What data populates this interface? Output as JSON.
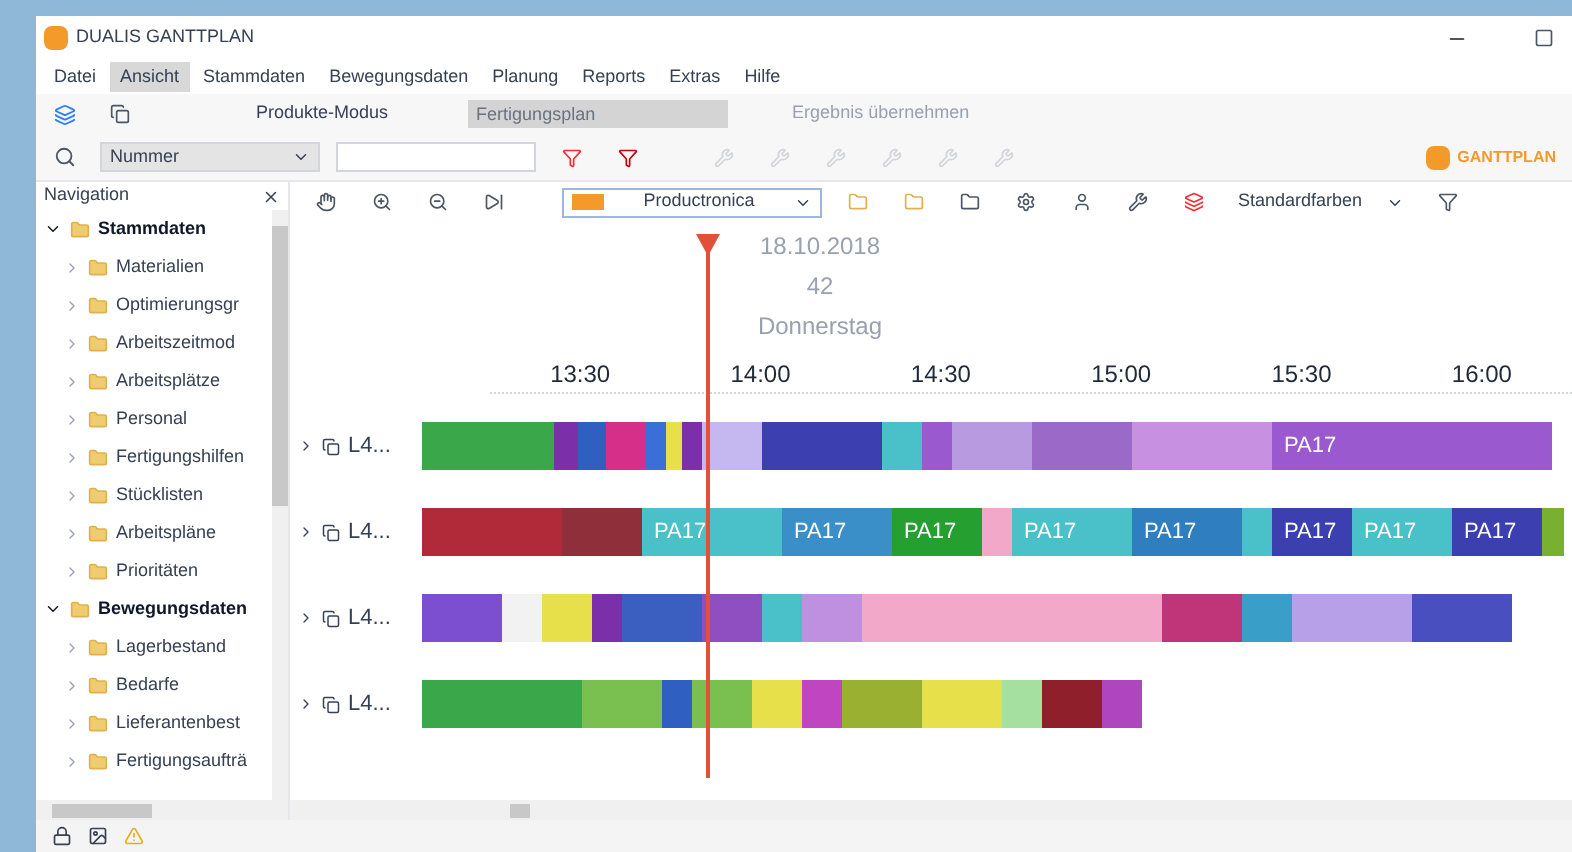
{
  "window": {
    "title": "DUALIS GANTTPLAN"
  },
  "menu": [
    {
      "label": "Datei",
      "selected": false
    },
    {
      "label": "Ansicht",
      "selected": true
    },
    {
      "label": "Stammdaten",
      "selected": false
    },
    {
      "label": "Bewegungsdaten",
      "selected": false
    },
    {
      "label": "Planung",
      "selected": false
    },
    {
      "label": "Reports",
      "selected": false
    },
    {
      "label": "Extras",
      "selected": false
    },
    {
      "label": "Hilfe",
      "selected": false
    }
  ],
  "mode_bar": {
    "mode": "Produkte-Modus",
    "plan_field": "Fertigungsplan",
    "apply": "Ergebnis übernehmen",
    "logo": "GANTTPLAN"
  },
  "search": {
    "field": "Nummer"
  },
  "navigation": {
    "title": "Navigation",
    "groups": [
      {
        "label": "Stammdaten",
        "expanded": true,
        "children": [
          {
            "label": "Materialien"
          },
          {
            "label": "Optimierungsgr"
          },
          {
            "label": "Arbeitszeitmod"
          },
          {
            "label": "Arbeitsplätze"
          },
          {
            "label": "Personal"
          },
          {
            "label": "Fertigungshilfen"
          },
          {
            "label": "Stücklisten"
          },
          {
            "label": "Arbeitspläne"
          },
          {
            "label": "Prioritäten"
          }
        ]
      },
      {
        "label": "Bewegungsdaten",
        "expanded": true,
        "children": [
          {
            "label": "Lagerbestand"
          },
          {
            "label": "Bedarfe"
          },
          {
            "label": "Lieferantenbest"
          },
          {
            "label": "Fertigungsaufträ"
          }
        ]
      }
    ]
  },
  "gantt": {
    "scenario": "Productronica",
    "colors": "Standardfarben",
    "date": "18.10.2018",
    "week": "42",
    "weekday": "Donnerstag",
    "times": [
      "13:30",
      "14:00",
      "14:30",
      "15:00",
      "15:30",
      "16:00"
    ],
    "rows": [
      {
        "label": "L4...",
        "tasks": [
          "PA17"
        ]
      },
      {
        "label": "L4...",
        "tasks": [
          "PA17",
          "PA17",
          "PA17",
          "PA17",
          "PA17",
          "PA17",
          "PA17",
          "PA17"
        ]
      },
      {
        "label": "L4...",
        "tasks": []
      },
      {
        "label": "L4...",
        "tasks": []
      }
    ]
  }
}
